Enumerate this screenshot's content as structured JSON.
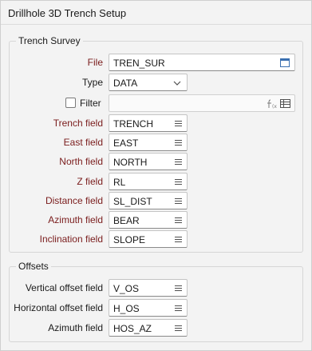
{
  "window": {
    "title": "Drillhole 3D Trench Setup"
  },
  "trench_survey": {
    "group_label": "Trench Survey",
    "file": {
      "label": "File",
      "value": "TREN_SUR"
    },
    "type": {
      "label": "Type",
      "value": "DATA"
    },
    "filter": {
      "label": "Filter",
      "value": "",
      "checked": false
    },
    "fields": [
      {
        "label": "Trench field",
        "value": "TRENCH"
      },
      {
        "label": "East field",
        "value": "EAST"
      },
      {
        "label": "North field",
        "value": "NORTH"
      },
      {
        "label": "Z field",
        "value": "RL"
      },
      {
        "label": "Distance field",
        "value": "SL_DIST"
      },
      {
        "label": "Azimuth field",
        "value": "BEAR"
      },
      {
        "label": "Inclination field",
        "value": "SLOPE"
      }
    ]
  },
  "offsets": {
    "group_label": "Offsets",
    "fields": [
      {
        "label": "Vertical offset field",
        "value": "V_OS"
      },
      {
        "label": "Horizontal offset field",
        "value": "H_OS"
      },
      {
        "label": "Azimuth field",
        "value": "HOS_AZ"
      }
    ]
  },
  "colors": {
    "required_label": "#7a1c1c",
    "background": "#f3f3f3",
    "icon": "#505050"
  },
  "icons": {
    "file_browse": "file-browse-icon",
    "dropdown": "chevron-down-icon",
    "expression": "function-icon",
    "list_picker": "list-icon"
  }
}
